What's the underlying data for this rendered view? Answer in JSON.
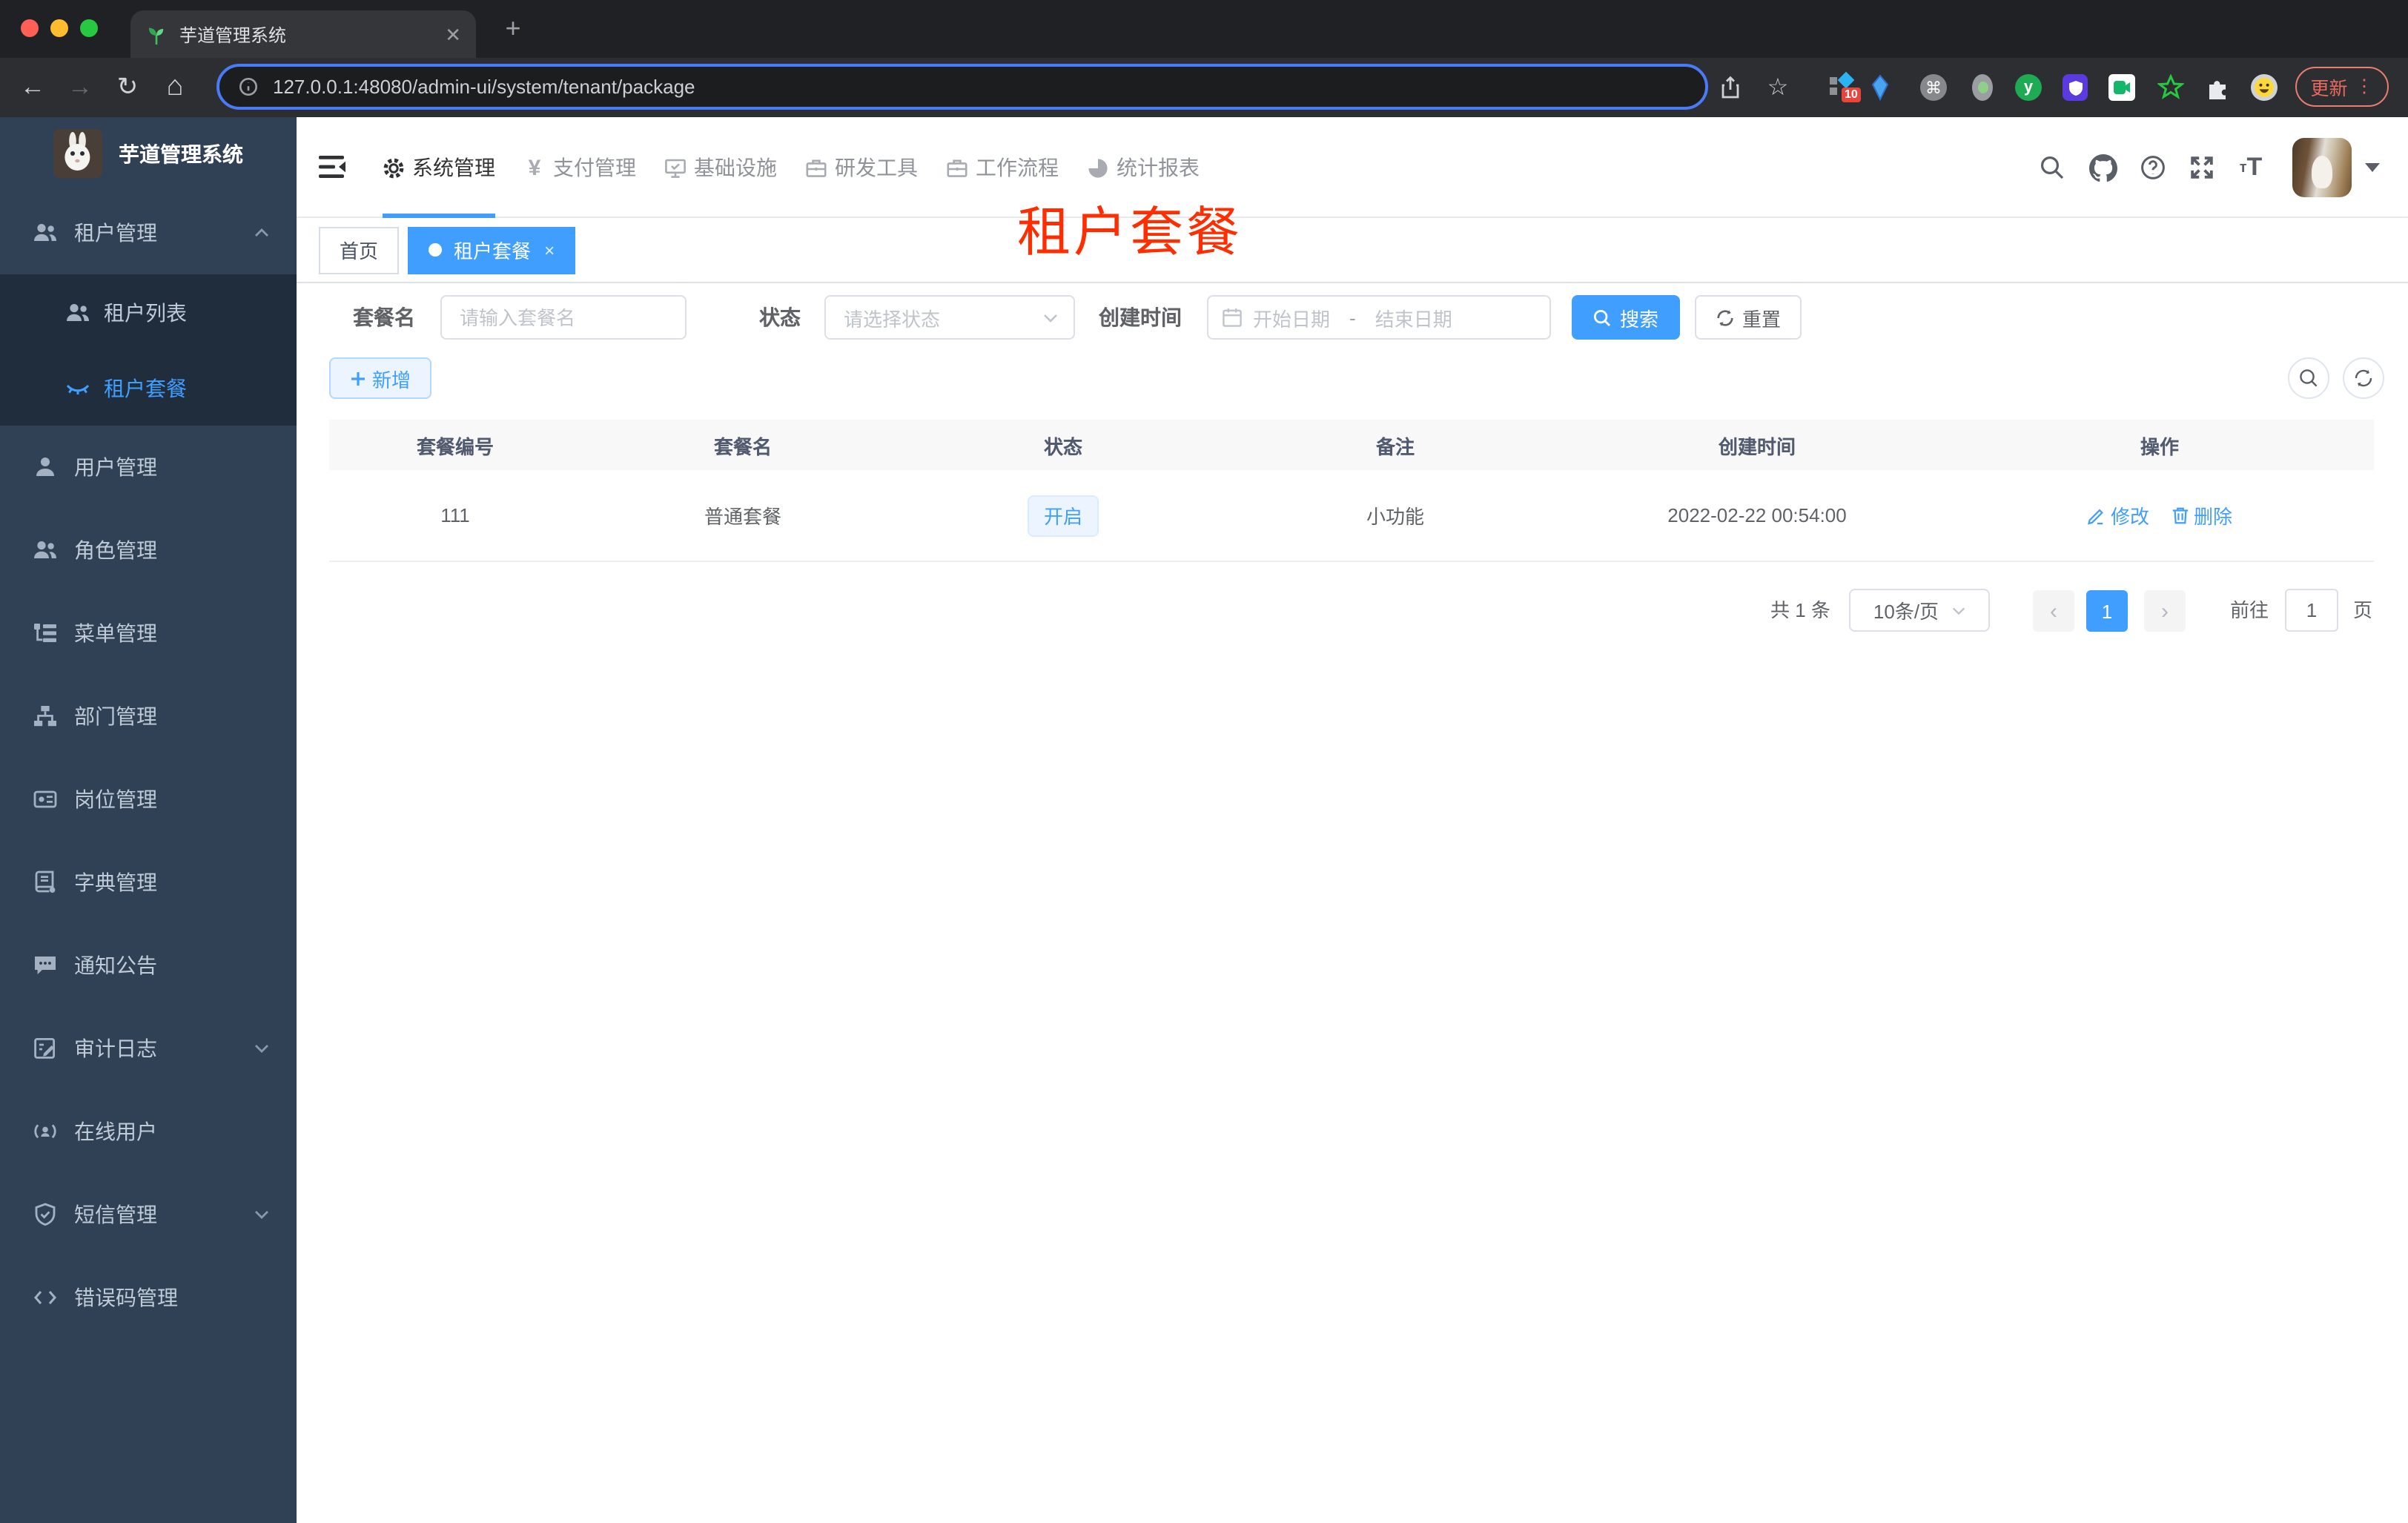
{
  "colors": {
    "accent": "#409eff",
    "annotation_red": "#ff2d00",
    "sidebar_bg": "#304156",
    "submenu_bg": "#1f2d3d",
    "sidebar_text": "#bfcbd9",
    "tag_open_bg": "#ecf5ff"
  },
  "browser": {
    "traffic_lights": [
      "close",
      "minimize",
      "zoom"
    ],
    "tab": {
      "favicon_icon": "seedling-icon",
      "title": "芋道管理系统",
      "close_icon": "close-icon"
    },
    "new_tab_icon": "plus-icon",
    "toolbar_icons": [
      "back-arrow-icon",
      "forward-arrow-icon",
      "reload-icon",
      "home-icon"
    ],
    "back_glyph": "←",
    "forward_glyph": "→",
    "reload_glyph": "↻",
    "home_glyph": "⌂",
    "omnibox": {
      "info_icon": "info-icon",
      "url": "127.0.0.1:48080/admin-ui/system/tenant/package"
    },
    "share_icon": "share-icon",
    "bookmark_icon": "star-icon",
    "bookmark_glyph": "☆",
    "extensions": [
      {
        "name": "stats-extension-icon",
        "badge": "10"
      },
      {
        "name": "gem-extension-icon"
      },
      {
        "name": "command-extension-icon",
        "glyph": "⌘"
      },
      {
        "name": "dot-extension-icon"
      },
      {
        "name": "y-circle-extension-icon",
        "glyph": "y"
      },
      {
        "name": "shield-extension-icon"
      },
      {
        "name": "chat-extension-icon"
      },
      {
        "name": "star-extension-icon"
      },
      {
        "name": "puzzle-extension-icon"
      },
      {
        "name": "smiley-extension-icon"
      }
    ],
    "update_button": {
      "label": "更新",
      "menu_glyph": "⋮"
    }
  },
  "app": {
    "logo": {
      "image": "rabbit-avatar",
      "title": "芋道管理系统"
    },
    "top_nav": {
      "collapse_icon": "hamburger-icon",
      "items": [
        {
          "label": "系统管理",
          "icon": "gear-icon",
          "active": true
        },
        {
          "label": "支付管理",
          "icon": "yen-icon",
          "glyph": "¥",
          "active": false
        },
        {
          "label": "基础设施",
          "icon": "monitor-icon",
          "active": false
        },
        {
          "label": "研发工具",
          "icon": "toolbox-icon",
          "active": false
        },
        {
          "label": "工作流程",
          "icon": "workflow-icon",
          "active": false
        },
        {
          "label": "统计报表",
          "icon": "dashboard-icon",
          "active": false
        }
      ],
      "actions": [
        "search-icon",
        "github-icon",
        "help-icon",
        "fullscreen-icon",
        "font-size-icon"
      ],
      "font_size_small": "т",
      "font_size_big": "T",
      "user": {
        "avatar": "cat-avatar",
        "caret_icon": "caret-down-icon"
      }
    },
    "sidebar": {
      "items": [
        {
          "label": "租户管理",
          "icon": "tenant-peoples-icon",
          "depth": 1,
          "arrow": "up"
        },
        {
          "label": "租户列表",
          "icon": "tenant-list-icon",
          "depth": 2,
          "active": false
        },
        {
          "label": "租户套餐",
          "icon": "eye-closed-icon",
          "depth": 2,
          "active": true
        },
        {
          "label": "用户管理",
          "icon": "user-icon",
          "depth": 1
        },
        {
          "label": "角色管理",
          "icon": "roles-icon",
          "depth": 1
        },
        {
          "label": "菜单管理",
          "icon": "menu-tree-icon",
          "depth": 1
        },
        {
          "label": "部门管理",
          "icon": "org-tree-icon",
          "depth": 1
        },
        {
          "label": "岗位管理",
          "icon": "post-badge-icon",
          "depth": 1
        },
        {
          "label": "字典管理",
          "icon": "dictionary-icon",
          "depth": 1
        },
        {
          "label": "通知公告",
          "icon": "announcement-icon",
          "depth": 1
        },
        {
          "label": "审计日志",
          "icon": "audit-log-icon",
          "depth": 1,
          "arrow": "down"
        },
        {
          "label": "在线用户",
          "icon": "online-user-icon",
          "depth": 1
        },
        {
          "label": "短信管理",
          "icon": "sms-shield-icon",
          "depth": 1,
          "arrow": "down"
        },
        {
          "label": "错误码管理",
          "icon": "error-code-icon",
          "depth": 1
        }
      ]
    },
    "tags_view": [
      {
        "label": "首页",
        "active": false,
        "closable": false
      },
      {
        "label": "租户套餐",
        "active": true,
        "closable": true
      }
    ],
    "annotation": "租户套餐",
    "filters": {
      "name_label": "套餐名",
      "name_placeholder": "请输入套餐名",
      "status_label": "状态",
      "status_placeholder": "请选择状态",
      "date_label": "创建时间",
      "date_start_placeholder": "开始日期",
      "date_separator": "-",
      "date_end_placeholder": "结束日期",
      "search_label": "搜索",
      "reset_label": "重置"
    },
    "toolbar": {
      "add_label": "新增",
      "refresh_icon": "refresh-icon",
      "search_toggle_icon": "search-icon"
    },
    "table": {
      "headers": [
        "套餐编号",
        "套餐名",
        "状态",
        "备注",
        "创建时间",
        "操作"
      ],
      "rows": [
        {
          "id": "111",
          "name": "普通套餐",
          "status": "开启",
          "remark": "小功能",
          "created_at": "2022-02-22 00:54:00",
          "edit_label": "修改",
          "delete_label": "删除"
        }
      ]
    },
    "pagination": {
      "total_text": "共 1 条",
      "page_size": "10条/页",
      "prev_glyph": "‹",
      "next_glyph": "›",
      "current_page": "1",
      "goto_label": "前往",
      "goto_value": "1",
      "page_unit": "页"
    }
  }
}
